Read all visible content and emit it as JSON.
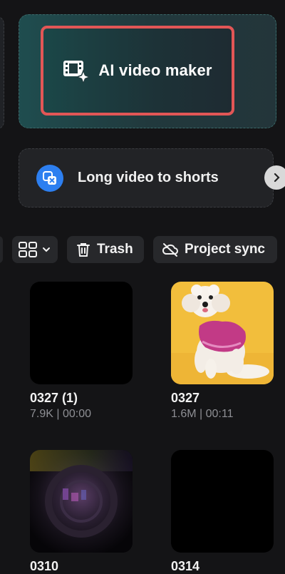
{
  "ai_card": {
    "label": "AI video maker",
    "icon": "film-sparkle-icon",
    "highlight_color": "#e25656"
  },
  "shorts_card": {
    "label": "Long video to shorts",
    "icon": "clip-cut-icon",
    "accent": "#2d7ff0"
  },
  "toolbar": {
    "view_icon": "grid-view-icon",
    "trash_label": "Trash",
    "sync_label": "Project sync"
  },
  "projects": [
    {
      "name": "0327 (1)",
      "meta": "7.9K | 00:00",
      "thumb": "black"
    },
    {
      "name": "0327",
      "meta": "1.6M | 00:11",
      "thumb": "dog-photo"
    },
    {
      "name": "0310",
      "meta": "",
      "thumb": "dark-lens-photo"
    },
    {
      "name": "0314",
      "meta": "",
      "thumb": "black"
    }
  ]
}
